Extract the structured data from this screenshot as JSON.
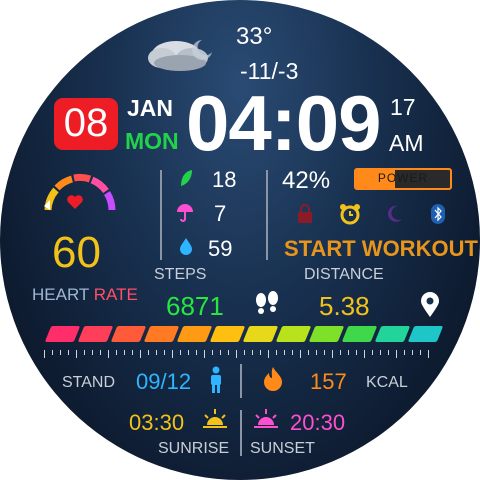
{
  "weather": {
    "temperature": "33°",
    "range": "-11/-3",
    "icon": "cloudy-night-icon"
  },
  "date": {
    "day_number": "08",
    "month": "JAN",
    "weekday": "MON"
  },
  "time": {
    "clock": "04:09",
    "seconds": "17",
    "ampm": "AM"
  },
  "heart": {
    "value": "60",
    "label_heart": "HEART",
    "label_rate": "RATE",
    "icon": "heart-icon"
  },
  "activity": {
    "leaf_value": "18",
    "leaf_icon": "leaf-icon",
    "umbrella_value": "7",
    "umbrella_icon": "umbrella-icon",
    "drop_value": "59",
    "drop_icon": "water-drop-icon"
  },
  "battery": {
    "percent": "42%",
    "badge_label": "POWER",
    "level": 0.42
  },
  "status_icons": [
    "lock-icon",
    "alarm-clock-icon",
    "moon-icon",
    "bluetooth-icon"
  ],
  "workout": {
    "label": "START WORKOUT"
  },
  "steps": {
    "label": "STEPS",
    "value": "6871",
    "icon": "footprints-icon"
  },
  "distance": {
    "label": "DISTANCE",
    "value": "5.38",
    "icon": "location-pin-icon"
  },
  "stand": {
    "label": "STAND",
    "value": "09/12",
    "icon": "standing-person-icon"
  },
  "calories": {
    "value": "157",
    "unit": "KCAL",
    "icon": "flame-icon"
  },
  "sun": {
    "sunrise_time": "03:30",
    "sunrise_label": "SUNRISE",
    "sunset_time": "20:30",
    "sunset_label": "SUNSET"
  },
  "colors": {
    "date_badge": "#ee1c24",
    "weekday": "#22d24a",
    "heart_value": "#f2c218",
    "steps_value": "#27e63f",
    "distance_value": "#f2c218",
    "stand_value": "#2fb4ff",
    "calories_value": "#ff8a1a",
    "sunrise_value": "#f2c218",
    "sunset_value": "#ff4fd0",
    "workout": "#e8951c"
  }
}
